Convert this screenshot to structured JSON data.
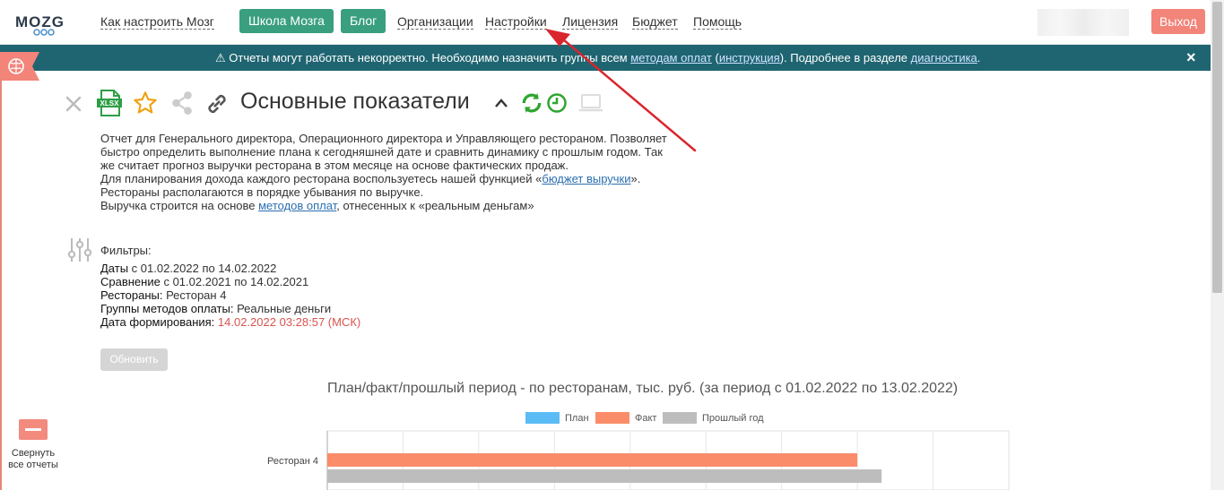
{
  "nav": {
    "logo_text": "MOZG",
    "links": [
      "Как настроить Мозг",
      "Организации",
      "Настройки",
      "Лицензия",
      "Бюджет",
      "Помощь"
    ],
    "school_button": "Школа Мозга",
    "blog_button": "Блог",
    "logout": "Выход"
  },
  "alert": {
    "icon": "warning-icon",
    "text_1": "Отчеты могут работать некорректно. Необходимо назначить группы всем ",
    "link_1": "методам оплат",
    "text_2": " (",
    "link_2": "инструкция",
    "text_3": "). Подробнее в разделе ",
    "link_3": "диагностика",
    "text_4": ".",
    "close": "×"
  },
  "toolbar": {
    "icons": [
      "close-icon",
      "xlsx-icon",
      "star-icon",
      "share-icon",
      "link-icon",
      "chevron-up-icon",
      "refresh-icon",
      "clock-icon",
      "laptop-icon"
    ],
    "xlsx_label": "XLSX",
    "title": "Основные показатели"
  },
  "description": {
    "line_1": "Отчет для Генерального директора, Операционного директора и Управляющего рестораном. Позволяет быстро определить выполнение плана к сегодняшней дате и сравнить динамику с прошлым годом. Так же считает прогноз выручки ресторана в этом месяце на основе фактических продаж.",
    "line_2_prefix": "Для планирования дохода каждого ресторана воспользуетесь нашей функцией «",
    "line_2_link": "бюджет выручки",
    "line_2_suffix": "».",
    "line_3": "Рестораны располагаются в порядке убывания по выручке.",
    "line_4_prefix": "Выручка строится на основе ",
    "line_4_link": "методов оплат",
    "line_4_suffix": ", отнесенных к «реальным деньгам»"
  },
  "filters": {
    "title": "Фильтры:",
    "dates_key": "Даты",
    "dates_val": " с 01.02.2022 по 14.02.2022",
    "compare_key": "Сравнение",
    "compare_val": " с 01.02.2021 по 14.02.2021",
    "restaurants_key": "Рестораны:",
    "restaurants_val": " Ресторан 4",
    "groups_key": "Группы методов оплаты:",
    "groups_val": " Реальные деньги",
    "generated_key": "Дата формирования:",
    "generated_val": " 14.02.2022 03:28:57 (МСК)"
  },
  "refresh_button": "Обновить",
  "collapse": {
    "label": "Свернуть все отчеты"
  },
  "colors": {
    "plan": "#5bbcf5",
    "fact": "#fb8c6a",
    "last_year": "#bdbdbd",
    "accent_green": "#3a9f7f",
    "alert_bg": "#1f6571",
    "logout": "#f2847a"
  },
  "chart_data": {
    "type": "bar",
    "orientation": "horizontal",
    "title": "План/факт/прошлый период - по ресторанам, тыс. руб. (за период с 01.02.2022 по 13.02.2022)",
    "categories": [
      "Ресторан 4"
    ],
    "series": [
      {
        "name": "План",
        "values": [
          0
        ]
      },
      {
        "name": "Факт",
        "values": [
          1750
        ]
      },
      {
        "name": "Прошлый год",
        "values": [
          1830
        ]
      }
    ],
    "xlim": [
      0,
      2250
    ],
    "grid": true,
    "legend": "top-center"
  }
}
